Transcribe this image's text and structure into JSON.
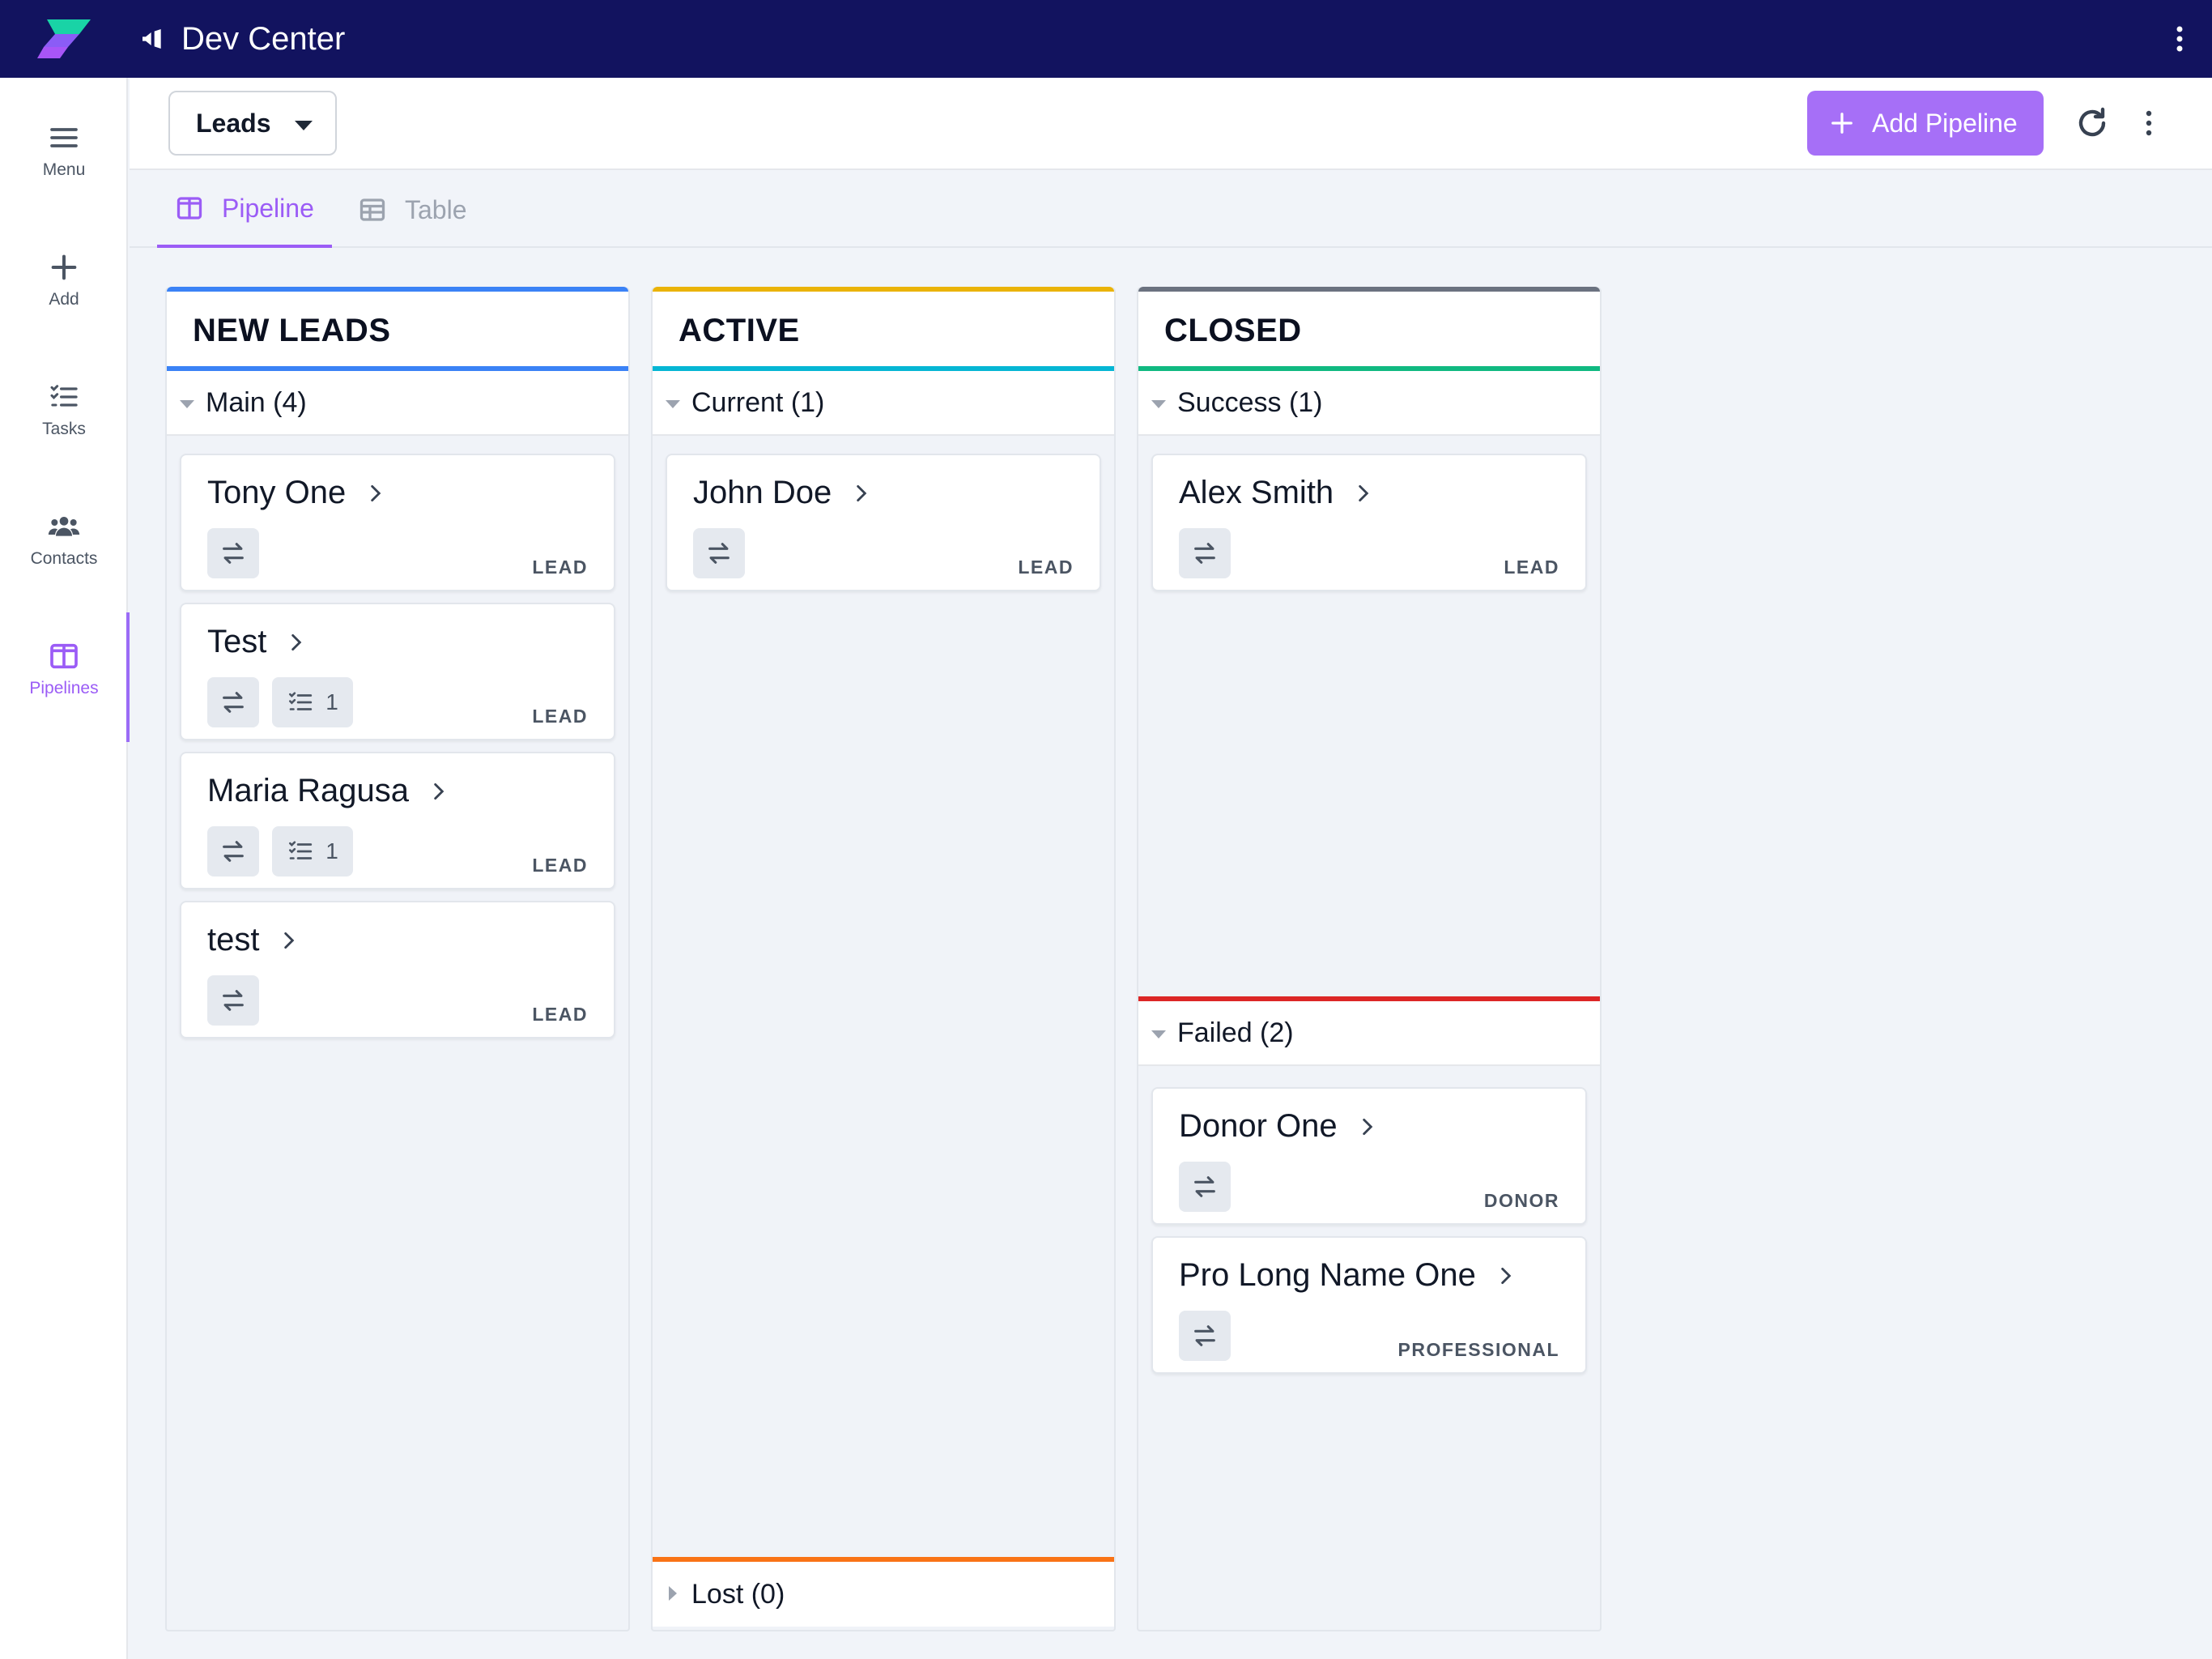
{
  "app": {
    "title": "Dev Center"
  },
  "sidebar": {
    "items": [
      {
        "label": "Menu",
        "icon": "hamburger-menu-icon"
      },
      {
        "label": "Add",
        "icon": "plus-icon"
      },
      {
        "label": "Tasks",
        "icon": "task-list-icon"
      },
      {
        "label": "Contacts",
        "icon": "people-icon"
      },
      {
        "label": "Pipelines",
        "icon": "pipeline-columns-icon",
        "active": true
      }
    ]
  },
  "toolbar": {
    "selected_pipeline": "Leads",
    "add_pipeline_label": "Add Pipeline"
  },
  "tabs": [
    {
      "label": "Pipeline",
      "active": true
    },
    {
      "label": "Table",
      "active": false
    }
  ],
  "colors": {
    "topbar": "#12135f",
    "accent": "#a66ff7",
    "new_leads": "#3b82f6",
    "active_top": "#eab308",
    "active_bottom": "#06b6d4",
    "closed_top": "#6b7280",
    "success": "#10b981",
    "failed": "#dc2626",
    "lost": "#f97316"
  },
  "columns": [
    {
      "title": "NEW LEADS",
      "groups": [
        {
          "label": "Main (4)",
          "cards": [
            {
              "name": "Tony One",
              "tag": "LEAD"
            },
            {
              "name": "Test",
              "tag": "LEAD",
              "tasks": "1"
            },
            {
              "name": "Maria Ragusa",
              "tag": "LEAD",
              "tasks": "1"
            },
            {
              "name": "test",
              "tag": "LEAD"
            }
          ]
        }
      ]
    },
    {
      "title": "ACTIVE",
      "groups": [
        {
          "label": "Current (1)",
          "cards": [
            {
              "name": "John Doe",
              "tag": "LEAD"
            }
          ]
        },
        {
          "label": "Lost (0)",
          "cards": []
        }
      ]
    },
    {
      "title": "CLOSED",
      "groups": [
        {
          "label": "Success (1)",
          "cards": [
            {
              "name": "Alex Smith",
              "tag": "LEAD"
            }
          ]
        },
        {
          "label": "Failed (2)",
          "cards": [
            {
              "name": "Donor One",
              "tag": "DONOR"
            },
            {
              "name": "Pro Long Name One",
              "tag": "PROFESSIONAL"
            }
          ]
        }
      ]
    }
  ]
}
